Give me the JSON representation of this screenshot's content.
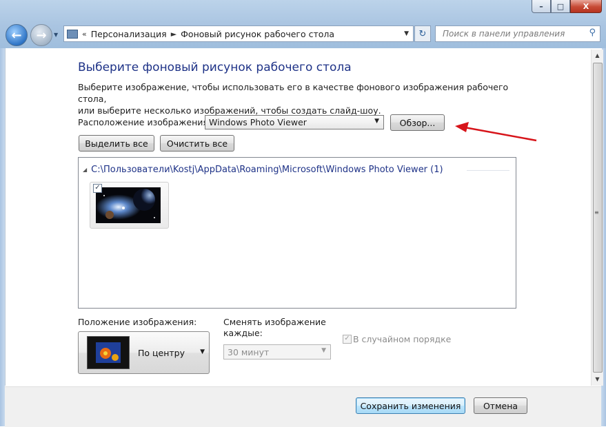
{
  "window": {
    "caption_buttons": {
      "minimize": "–",
      "maximize": "□",
      "close": "X"
    }
  },
  "nav": {
    "back_icon": "arrow-left-icon",
    "forward_icon": "arrow-right-icon",
    "breadcrumb_sep": "«",
    "breadcrumb": [
      "Персонализация",
      "Фоновый рисунок рабочего стола"
    ],
    "breadcrumb_arrow": "►"
  },
  "search": {
    "placeholder": "Поиск в панели управления"
  },
  "page": {
    "title": "Выберите фоновый рисунок рабочего стола",
    "description_line1": "Выберите изображение, чтобы использовать его в качестве фонового изображения рабочего стола,",
    "description_line2": "или выберите несколько изображений, чтобы создать слайд-шоу."
  },
  "location": {
    "label": "Расположение изображения:",
    "value": "Windows Photo Viewer",
    "browse_button": "Обзор..."
  },
  "buttons": {
    "select_all": "Выделить все",
    "clear_all": "Очистить все",
    "save": "Сохранить изменения",
    "cancel": "Отмена"
  },
  "gallery": {
    "group_path": "C:\\Пользователи\\Kostj\\AppData\\Roaming\\Microsoft\\Windows Photo Viewer (1)",
    "items": [
      {
        "checked": true,
        "thumb_icon": "space-wallpaper-thumbnail"
      }
    ]
  },
  "position": {
    "label": "Положение изображения:",
    "value": "По центру"
  },
  "interval": {
    "label_line1": "Сменять изображение",
    "label_line2": "каждые:",
    "value": "30 минут"
  },
  "shuffle": {
    "label": "В случайном порядке",
    "checked": true,
    "enabled": false
  },
  "colors": {
    "title_blue": "#1e3287",
    "annotation_arrow": "#d7141a"
  }
}
